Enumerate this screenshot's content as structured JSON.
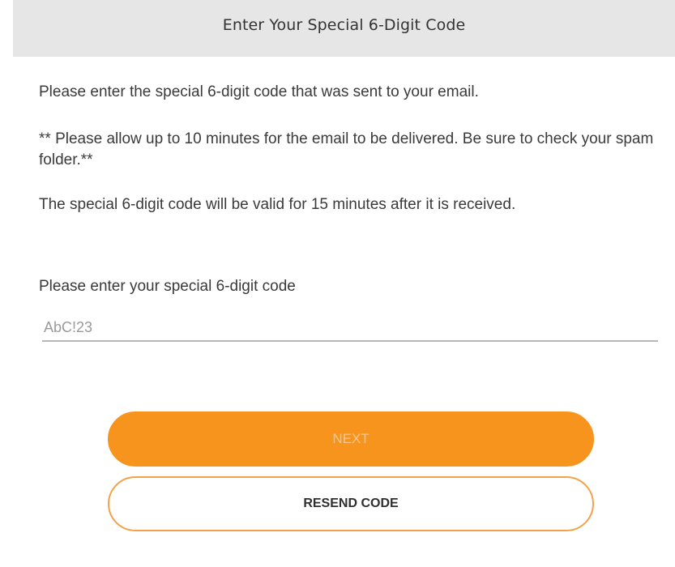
{
  "header": {
    "title": "Enter Your Special 6-Digit Code"
  },
  "instructions": {
    "line1": "Please enter the special 6-digit code that was sent to your email.",
    "line2": "** Please allow up to 10 minutes for the email to be delivered. Be sure to check your spam folder.**",
    "line3": "The special 6-digit code will be valid for 15 minutes after it is received."
  },
  "code_field": {
    "label": "Please enter your special 6-digit code",
    "value": "",
    "placeholder": "AbC!23"
  },
  "buttons": {
    "next_label": "NEXT",
    "resend_label": "RESEND CODE"
  },
  "colors": {
    "accent": "#f7941d",
    "header_bg": "#e6e6e6"
  }
}
